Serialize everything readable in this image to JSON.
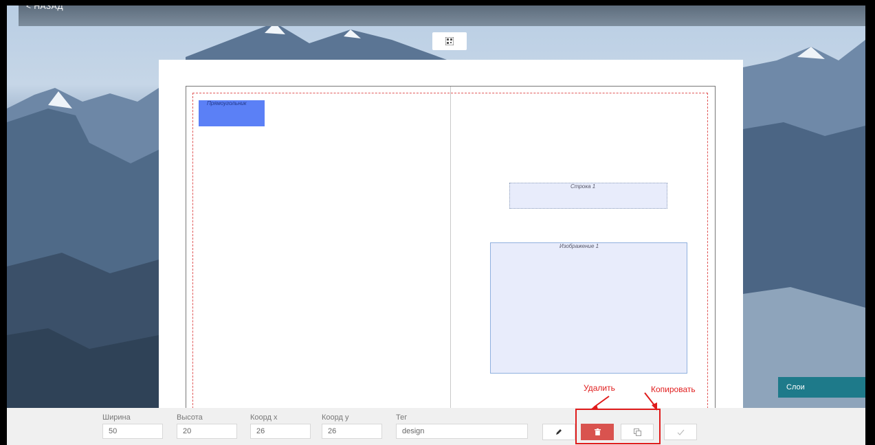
{
  "nav": {
    "back_label": "< НАЗАД"
  },
  "canvas": {
    "elements": {
      "rectangle_label": "Прямоугольник",
      "text_line_label": "Строка 1",
      "image_label": "Изображение 1"
    }
  },
  "layers_panel": {
    "button_label": "Слои"
  },
  "properties": {
    "width": {
      "label": "Ширина",
      "value": "50"
    },
    "height": {
      "label": "Высота",
      "value": "20"
    },
    "coord_x": {
      "label": "Коорд x",
      "value": "26"
    },
    "coord_y": {
      "label": "Коорд y",
      "value": "26"
    },
    "tag": {
      "label": "Тег",
      "value": "design"
    }
  },
  "toolbar": {
    "edit_icon": "pencil-icon",
    "delete_icon": "trash-icon",
    "copy_icon": "copy-icon",
    "confirm_icon": "checkmark-icon"
  },
  "annotations": {
    "delete_label": "Удалить",
    "copy_label": "Копировать"
  },
  "colors": {
    "rectangle_fill": "#5b80f6",
    "delete_button": "#d9534f",
    "layers_button": "#1e7a8a",
    "annotation": "#e01b1b"
  }
}
